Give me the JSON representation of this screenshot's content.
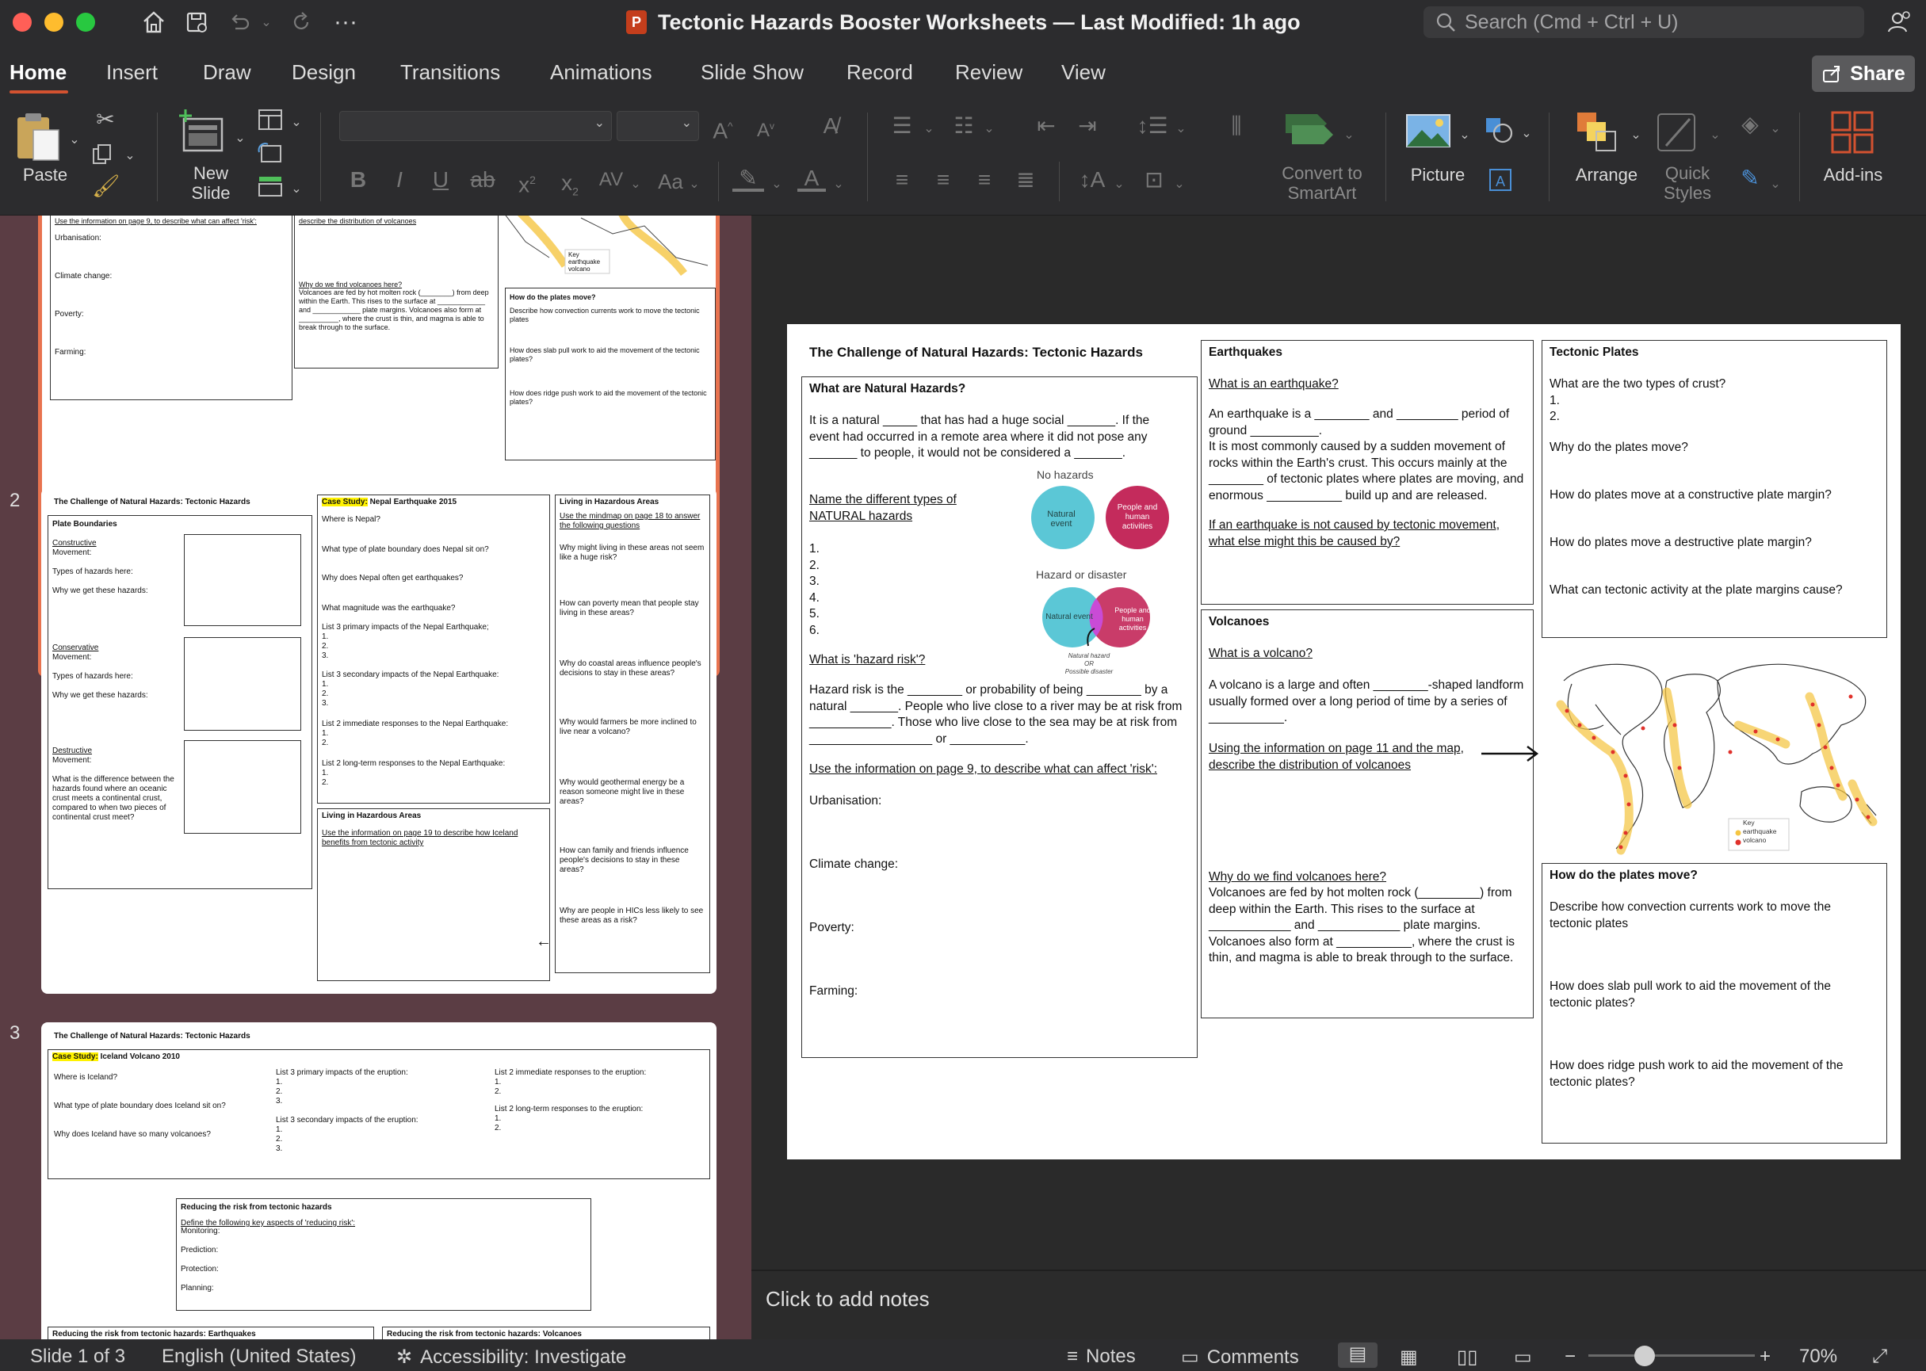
{
  "window": {
    "title": "Tectonic Hazards Booster Worksheets — Last Modified: 1h ago",
    "search_placeholder": "Search (Cmd + Ctrl + U)"
  },
  "menu": [
    "Home",
    "Insert",
    "Draw",
    "Design",
    "Transitions",
    "Animations",
    "Slide Show",
    "Record",
    "Review",
    "View"
  ],
  "share_label": "Share",
  "ribbon": {
    "paste": "Paste",
    "new_slide": "New\nSlide",
    "convert": "Convert to\nSmartArt",
    "picture": "Picture",
    "arrange": "Arrange",
    "quick_styles": "Quick\nStyles",
    "addins": "Add-ins"
  },
  "thumbnails": {
    "slide_numbers": [
      "2",
      "3"
    ],
    "t1": {
      "risk_heading": "Use the information on page 9, to describe what can affect 'risk':",
      "distribution": "describe the distribution of volcanoes",
      "urbanisation": "Urbanisation:",
      "climate": "Climate change:",
      "poverty": "Poverty:",
      "farming": "Farming:",
      "why_volcanoes": "Why do we find volcanoes here?",
      "volcano_text": "Volcanoes are fed by hot molten rock (________) from deep within the Earth. This rises to the surface at ____________ and ____________ plate margins. Volcanoes also form at __________, where the crust is thin, and magma is able to break through to the surface.",
      "plates_heading": "How do the plates move?",
      "plates_q1": "Describe how convection currents work to move the tectonic plates",
      "plates_q2": "How does slab pull work to aid the movement of the tectonic plates?",
      "plates_q3": "How does ridge push work to aid the movement of the tectonic plates?",
      "key": "Key\nearthquake\nvolcano"
    },
    "t2": {
      "title": "The Challenge of Natural Hazards: Tectonic Hazards",
      "plate_boundaries": "Plate Boundaries",
      "constructive": "Constructive",
      "conservative": "Conservative",
      "destructive": "Destructive",
      "movement": "Movement:",
      "types": "Types of hazards here:",
      "why": "Why we get these hazards:",
      "difference": "What is the difference between the hazards found where an oceanic crust meets a continental crust, compared to when two pieces of continental crust meet?",
      "case_study_label": "Case Study:",
      "case_study": " Nepal Earthquake 2015",
      "nepal_qs": [
        "Where is Nepal?",
        "What type of plate boundary does Nepal sit on?",
        "Why does Nepal often get earthquakes?",
        "What magnitude was the earthquake?",
        "List 3 primary impacts of the Nepal Earthquake;\n1.\n2.\n3.",
        "List 3 secondary impacts of the Nepal Earthquake:\n1.\n2.\n3.",
        "List 2 immediate responses to the Nepal Earthquake:\n1.\n2.",
        "List 2 long-term responses to the Nepal Earthquake:\n1.\n2."
      ],
      "living": "Living in Hazardous Areas",
      "iceland_task": "Use the information on page 19 to describe how Iceland benefits from tectonic activity",
      "mindmap_task": "Use the mindmap on page 18 to answer the following questions",
      "living_qs": [
        "Why might living in these areas not seem like a huge risk?",
        "How can poverty mean that people stay living in these areas?",
        "Why do coastal areas influence people's decisions to stay in these areas?",
        "Why would farmers be more inclined to live near a volcano?",
        "Why would geothermal energy be a reason someone might live in these areas?",
        "How can family and friends influence people's decisions to stay in these areas?",
        "Why are people in HICs less likely to see these areas as a risk?"
      ]
    },
    "t3": {
      "title": "The Challenge of Natural Hazards: Tectonic Hazards",
      "case_study_label": "Case Study:",
      "case_study": " Iceland Volcano 2010",
      "where": "Where is Iceland?",
      "boundary": "What type of plate boundary does Iceland sit on?",
      "many": "Why does Iceland have so many volcanoes?",
      "primary": "List 3 primary impacts of the eruption:\n1.\n2.\n3.",
      "secondary": "List 3 secondary impacts of the eruption:\n1.\n2.\n3.",
      "immediate": "List 2 immediate responses to the eruption:\n1.\n2.",
      "longterm": "List 2 long-term responses to the eruption:\n1.\n2.",
      "reducing": "Reducing the risk from tectonic hazards",
      "define": "Define the following key aspects of 'reducing risk':",
      "aspects": "Monitoring:\n\nPrediction:\n\nProtection:\n\nPlanning:",
      "reducing_eq": "Reducing the risk from tectonic hazards: Earthquakes",
      "reducing_vol": "Reducing the risk from tectonic hazards: Volcanoes"
    }
  },
  "slide": {
    "title": "The Challenge of Natural Hazards: Tectonic Hazards",
    "natural_hazards_heading": "What are Natural Hazards?",
    "nh_text": "It is a natural _____ that has had a huge social _______. If the event had occurred in a remote area where it did not pose any _______ to people, it would not be considered a _______.",
    "name_types": "Name the different types of NATURAL hazards",
    "numbers": "1.\n2.\n3.\n4.\n5.\n6.",
    "no_hazards": "No hazards",
    "hazard_or_disaster": "Hazard or disaster",
    "natural_event": "Natural event",
    "people": "People and human activities",
    "natural_hazard_note": "Natural hazard\nOR\nPossible disaster",
    "hazard_risk_heading": "What is 'hazard risk'?",
    "hazard_risk_text": "Hazard risk is the ________ or probability of being ________ by a natural _______.  People who live close to a river may be at risk from ____________. Those who live close to the sea may be at risk from __________________ or ___________.",
    "risk_heading": "Use the information on page 9, to describe what can affect 'risk':",
    "urbanisation": "Urbanisation:",
    "climate": "Climate change:",
    "poverty": "Poverty:",
    "farming": "Farming:",
    "eq_heading": "Earthquakes",
    "eq_q": "What is an earthquake?",
    "eq_text": "An earthquake is a ________ and _________ period of ground __________.\nIt is most commonly caused by a sudden movement of rocks within the Earth's crust. This occurs mainly at the ________ of tectonic plates where plates are moving, and enormous ___________ build up and are released.",
    "eq_q2": "If an earthquake is not caused by tectonic movement, what else might this be caused by?",
    "tp_heading": "Tectonic Plates",
    "tp_q1": "What are the two types of crust?\n1.\n2.",
    "tp_q2": "Why do the plates move?",
    "tp_q3": "How do plates move at a constructive plate margin?",
    "tp_q4": "How do plates move a destructive plate margin?",
    "tp_q5": "What can tectonic activity at the plate margins cause?",
    "vol_heading": "Volcanoes",
    "vol_q": "What is a volcano?",
    "vol_text": "A volcano is a large and often ________-shaped landform usually formed over a long period of time by a series of ___________.",
    "vol_map_task": "Using the information on page 11 and the map, describe the distribution of volcanoes",
    "why_volcanoes": "Why do we find volcanoes here?",
    "vol_text2": "Volcanoes are fed by hot molten rock (_________) from deep within the Earth. This rises to the surface at ____________ and ____________ plate margins. Volcanoes also form at ___________, where the crust is thin, and magma is able to break through to the surface.",
    "map_key": "Key\nearthquake\nvolcano",
    "plates_heading": "How do the plates move?",
    "plates_q1": "Describe how convection currents work to move the tectonic plates",
    "plates_q2": "How does slab pull work to aid the movement of the tectonic plates?",
    "plates_q3": "How does ridge push work to aid the movement of the tectonic plates?"
  },
  "notes_placeholder": "Click to add notes",
  "status": {
    "slide": "Slide 1 of 3",
    "language": "English (United States)",
    "accessibility": "Accessibility: Investigate",
    "notes": "Notes",
    "comments": "Comments",
    "zoom": "70%"
  }
}
